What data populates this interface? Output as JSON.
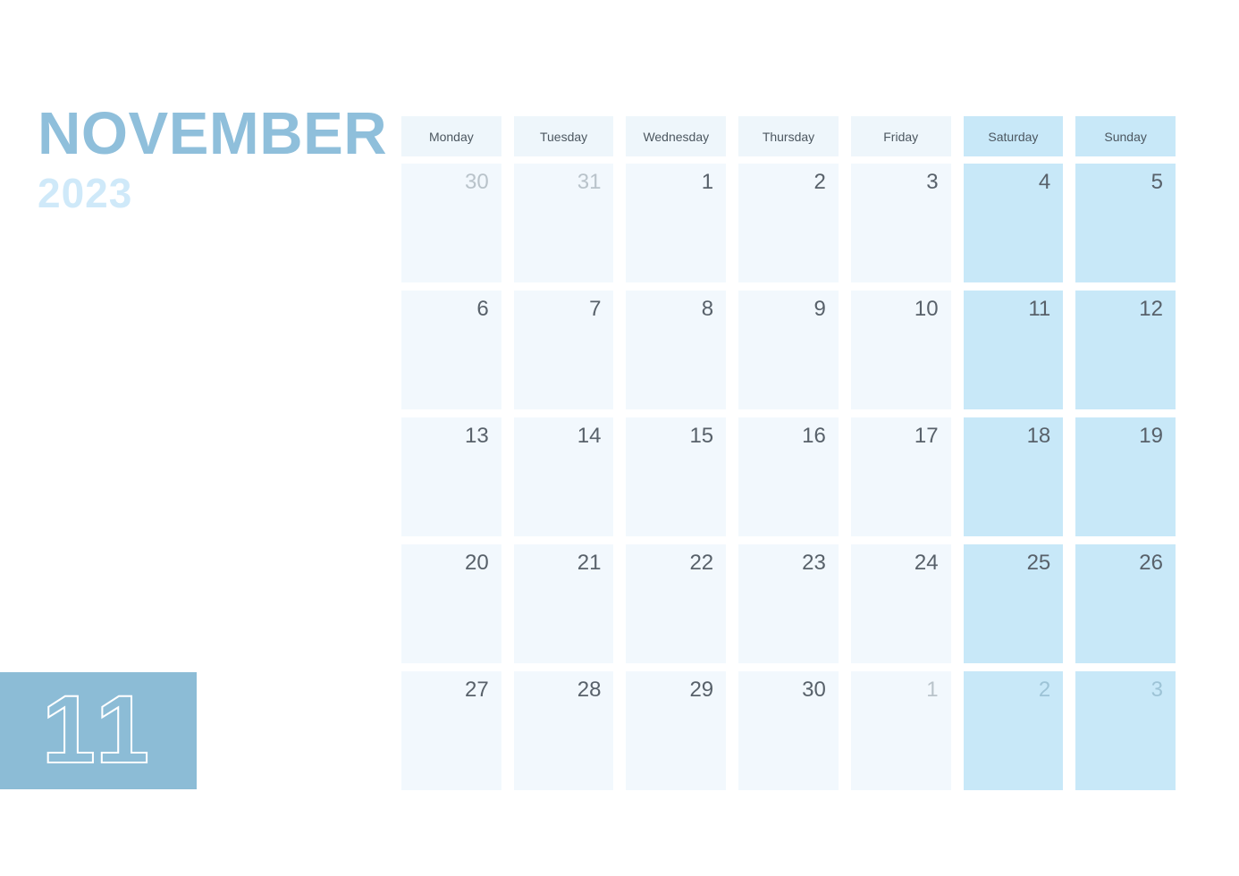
{
  "title": {
    "month": "NOVEMBER",
    "year": "2023",
    "month_color": "#8fbfdb",
    "year_color": "#cfe9f9"
  },
  "badge": {
    "month_number": "11",
    "background_color": "#8cbcd6",
    "outline_color": "#ffffff"
  },
  "calendar": {
    "weekday_headers": [
      {
        "label": "Monday",
        "weekend": false
      },
      {
        "label": "Tuesday",
        "weekend": false
      },
      {
        "label": "Wednesday",
        "weekend": false
      },
      {
        "label": "Thursday",
        "weekend": false
      },
      {
        "label": "Friday",
        "weekend": false
      },
      {
        "label": "Saturday",
        "weekend": true
      },
      {
        "label": "Sunday",
        "weekend": true
      }
    ],
    "colors": {
      "weekday_header_bg": "#eef6fb",
      "weekend_header_bg": "#c8e8f8",
      "weekday_cell_bg": "#f2f8fd",
      "weekend_cell_bg": "#c8e8f8",
      "date_text": "#58616a",
      "muted_date_text": "#b9c3ca"
    },
    "weeks": [
      [
        {
          "day": "30",
          "current_month": false,
          "weekend": false
        },
        {
          "day": "31",
          "current_month": false,
          "weekend": false
        },
        {
          "day": "1",
          "current_month": true,
          "weekend": false
        },
        {
          "day": "2",
          "current_month": true,
          "weekend": false
        },
        {
          "day": "3",
          "current_month": true,
          "weekend": false
        },
        {
          "day": "4",
          "current_month": true,
          "weekend": true
        },
        {
          "day": "5",
          "current_month": true,
          "weekend": true
        }
      ],
      [
        {
          "day": "6",
          "current_month": true,
          "weekend": false
        },
        {
          "day": "7",
          "current_month": true,
          "weekend": false
        },
        {
          "day": "8",
          "current_month": true,
          "weekend": false
        },
        {
          "day": "9",
          "current_month": true,
          "weekend": false
        },
        {
          "day": "10",
          "current_month": true,
          "weekend": false
        },
        {
          "day": "11",
          "current_month": true,
          "weekend": true
        },
        {
          "day": "12",
          "current_month": true,
          "weekend": true
        }
      ],
      [
        {
          "day": "13",
          "current_month": true,
          "weekend": false
        },
        {
          "day": "14",
          "current_month": true,
          "weekend": false
        },
        {
          "day": "15",
          "current_month": true,
          "weekend": false
        },
        {
          "day": "16",
          "current_month": true,
          "weekend": false
        },
        {
          "day": "17",
          "current_month": true,
          "weekend": false
        },
        {
          "day": "18",
          "current_month": true,
          "weekend": true
        },
        {
          "day": "19",
          "current_month": true,
          "weekend": true
        }
      ],
      [
        {
          "day": "20",
          "current_month": true,
          "weekend": false
        },
        {
          "day": "21",
          "current_month": true,
          "weekend": false
        },
        {
          "day": "22",
          "current_month": true,
          "weekend": false
        },
        {
          "day": "23",
          "current_month": true,
          "weekend": false
        },
        {
          "day": "24",
          "current_month": true,
          "weekend": false
        },
        {
          "day": "25",
          "current_month": true,
          "weekend": true
        },
        {
          "day": "26",
          "current_month": true,
          "weekend": true
        }
      ],
      [
        {
          "day": "27",
          "current_month": true,
          "weekend": false
        },
        {
          "day": "28",
          "current_month": true,
          "weekend": false
        },
        {
          "day": "29",
          "current_month": true,
          "weekend": false
        },
        {
          "day": "30",
          "current_month": true,
          "weekend": false
        },
        {
          "day": "1",
          "current_month": false,
          "weekend": false
        },
        {
          "day": "2",
          "current_month": false,
          "weekend": true
        },
        {
          "day": "3",
          "current_month": false,
          "weekend": true
        }
      ]
    ]
  }
}
